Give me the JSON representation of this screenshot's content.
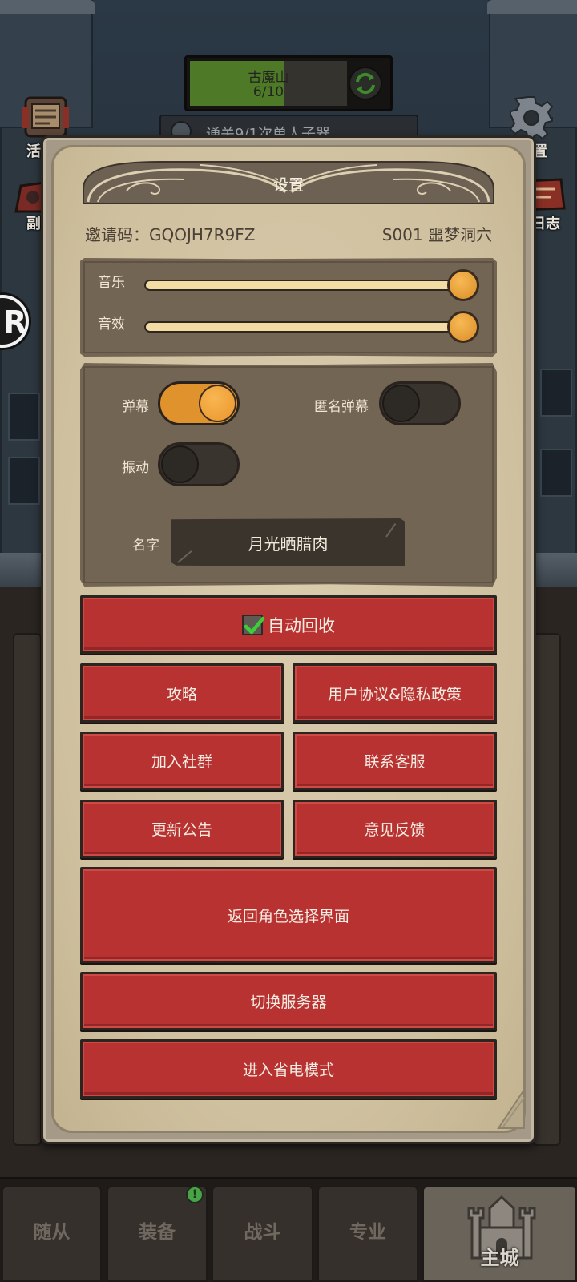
{
  "theme": {
    "parchment": "#d3c5a5",
    "panel": "#736554",
    "button_red": "#b83232",
    "toggle_on": "#e0922d",
    "toggle_off": "#3a342e",
    "knob": "#e39a34",
    "progress_green": "#4e7a28",
    "text_dark": "#4b4036",
    "text_light": "#f4ece1"
  },
  "background": {
    "quest": {
      "title": "古魔山",
      "count": "6/10",
      "progress": 0.6,
      "icon": "refresh-icon"
    },
    "task": {
      "text": "通关9/1次单人子器"
    },
    "left_icons": [
      {
        "label": "活",
        "icon": "scroll-icon"
      },
      {
        "label": "副",
        "icon": "dungeon-icon"
      }
    ],
    "right_icons": [
      {
        "label": "置",
        "icon": "gear-icon"
      },
      {
        "label": "日志",
        "icon": "log-icon"
      }
    ],
    "edge_badge": "R"
  },
  "dialog": {
    "title": "设置",
    "invite": {
      "label": "邀请码：",
      "code": "GQOJH7R9FZ"
    },
    "server": "S001 噩梦洞穴",
    "audio": {
      "music": {
        "label": "音乐",
        "level": 1.0
      },
      "sfx": {
        "label": "音效",
        "level": 1.0
      }
    },
    "toggles": {
      "danmaku": {
        "label": "弹幕",
        "on": true
      },
      "anonymous_danmaku": {
        "label": "匿名弹幕",
        "on": false
      },
      "vibration": {
        "label": "振动",
        "on": false
      }
    },
    "name": {
      "label": "名字",
      "value": "月光晒腊肉"
    },
    "auto_recycle": {
      "label": "自动回收",
      "checked": true
    },
    "buttons": {
      "guide": "攻略",
      "agreement": "用户协议&隐私政策",
      "join_community": "加入社群",
      "contact_support": "联系客服",
      "update_notice": "更新公告",
      "feedback": "意见反馈",
      "back_to_character_select": "返回角色选择界面",
      "switch_server": "切换服务器",
      "power_saving": "进入省电模式"
    }
  },
  "bottom_nav": {
    "tabs": [
      {
        "label": "随从"
      },
      {
        "label": "装备",
        "badge": "!"
      },
      {
        "label": "战斗"
      },
      {
        "label": "专业"
      },
      {
        "label": "主城",
        "active": true
      }
    ]
  }
}
